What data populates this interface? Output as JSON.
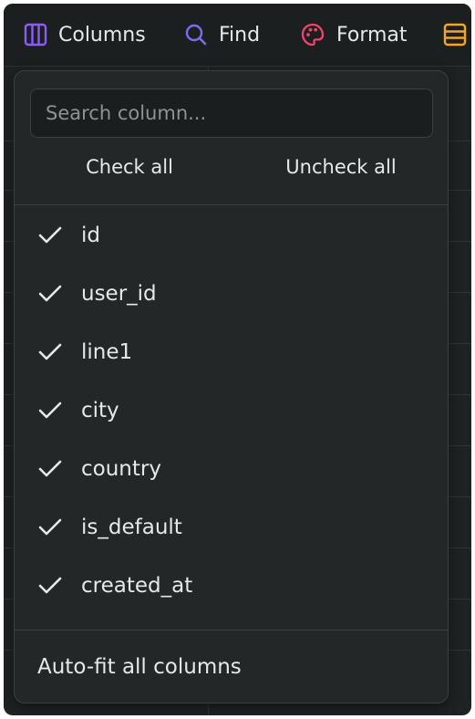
{
  "toolbar": {
    "columns_label": "Columns",
    "find_label": "Find",
    "format_label": "Format",
    "columns_icon": "columns-icon",
    "find_icon": "search-icon",
    "format_icon": "palette-icon",
    "more_icon": "rows-icon",
    "colors": {
      "columns": "#8b5cf6",
      "find": "#7c6cf2",
      "format": "#f0446c",
      "more": "#f5a623"
    }
  },
  "popover": {
    "search_placeholder": "Search column...",
    "search_value": "",
    "check_all_label": "Check all",
    "uncheck_all_label": "Uncheck all",
    "columns": [
      {
        "label": "id",
        "checked": true
      },
      {
        "label": "user_id",
        "checked": true
      },
      {
        "label": "line1",
        "checked": true
      },
      {
        "label": "city",
        "checked": true
      },
      {
        "label": "country",
        "checked": true
      },
      {
        "label": "is_default",
        "checked": true
      },
      {
        "label": "created_at",
        "checked": true
      }
    ],
    "autofit_label": "Auto-fit all columns"
  }
}
